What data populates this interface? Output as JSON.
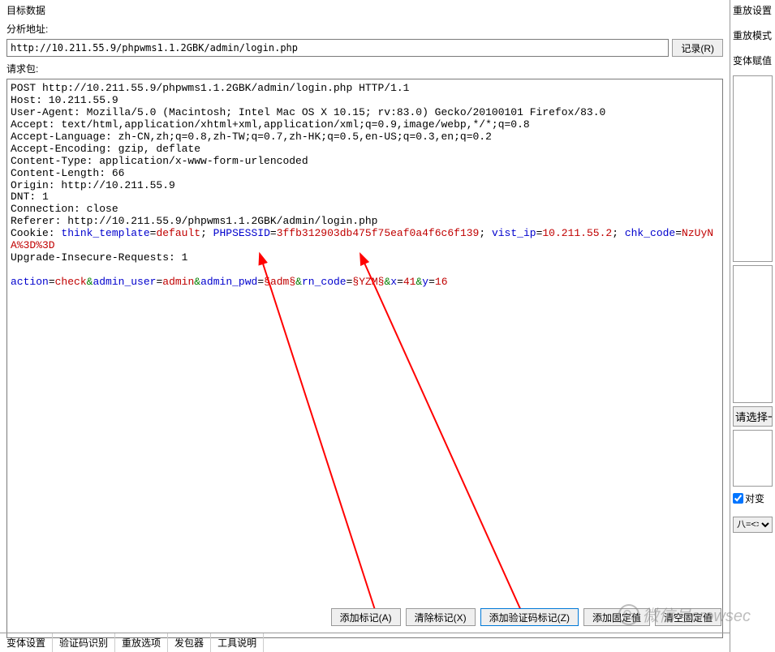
{
  "labels": {
    "target_data": "目标数据",
    "analyze_addr": "分析地址:",
    "record_btn": "记录(R)",
    "request_pkg": "请求包:",
    "add_mark": "添加标记(A)",
    "clear_mark": "清除标记(X)",
    "add_captcha_mark": "添加验证码标记(Z)",
    "add_fixed": "添加固定值",
    "clear_fixed": "清空固定值"
  },
  "address": "http://10.211.55.9/phpwms1.1.2GBK/admin/login.php",
  "right": {
    "replay_settings": "重放设置",
    "replay_mode": "重放模式",
    "body_assign": "变体赋值",
    "please_select": "请选择一",
    "checkbox": "对变",
    "select_val": "八=<>§"
  },
  "tabs": {
    "t1": "变体设置",
    "t2": "验证码识别",
    "t3": "重放选项",
    "t4": "发包器",
    "t5": "工具说明"
  },
  "watermark": "微信号crowsec",
  "http": {
    "line1": "POST http://10.211.55.9/phpwms1.1.2GBK/admin/login.php HTTP/1.1",
    "line2": "Host: 10.211.55.9",
    "line3": "User-Agent: Mozilla/5.0 (Macintosh; Intel Mac OS X 10.15; rv:83.0) Gecko/20100101 Firefox/83.0",
    "line4": "Accept: text/html,application/xhtml+xml,application/xml;q=0.9,image/webp,*/*;q=0.8",
    "line5": "Accept-Language: zh-CN,zh;q=0.8,zh-TW;q=0.7,zh-HK;q=0.5,en-US;q=0.3,en;q=0.2",
    "line6": "Accept-Encoding: gzip, deflate",
    "line7": "Content-Type: application/x-www-form-urlencoded",
    "line8": "Content-Length: 66",
    "line9": "Origin: http://10.211.55.9",
    "line10": "DNT: 1",
    "line11": "Connection: close",
    "line12": "Referer: http://10.211.55.9/phpwms1.1.2GBK/admin/login.php",
    "cookie_prefix": "Cookie: ",
    "ck1_k": "think_template",
    "ck1_v": "default",
    "ck2_k": "PHPSESSID",
    "ck2_v": "3ffb312903db475f75eaf0a4f6c6f139",
    "ck3_k": "vist_ip",
    "ck3_v": "10.211.55.2",
    "ck4_k": "chk_code",
    "ck4_v": "NzUyNA%3D%3D",
    "line14": "Upgrade-Insecure-Requests: 1",
    "body": {
      "action_k": "action",
      "action_v": "check",
      "user_k": "admin_user",
      "user_v": "admin",
      "pwd_k": "admin_pwd",
      "pwd_v": "adm",
      "rn_k": "rn_code",
      "rn_v": "YZM",
      "x_k": "x",
      "x_v": "41",
      "y_k": "y",
      "y_v": "16",
      "marker": "§"
    }
  }
}
